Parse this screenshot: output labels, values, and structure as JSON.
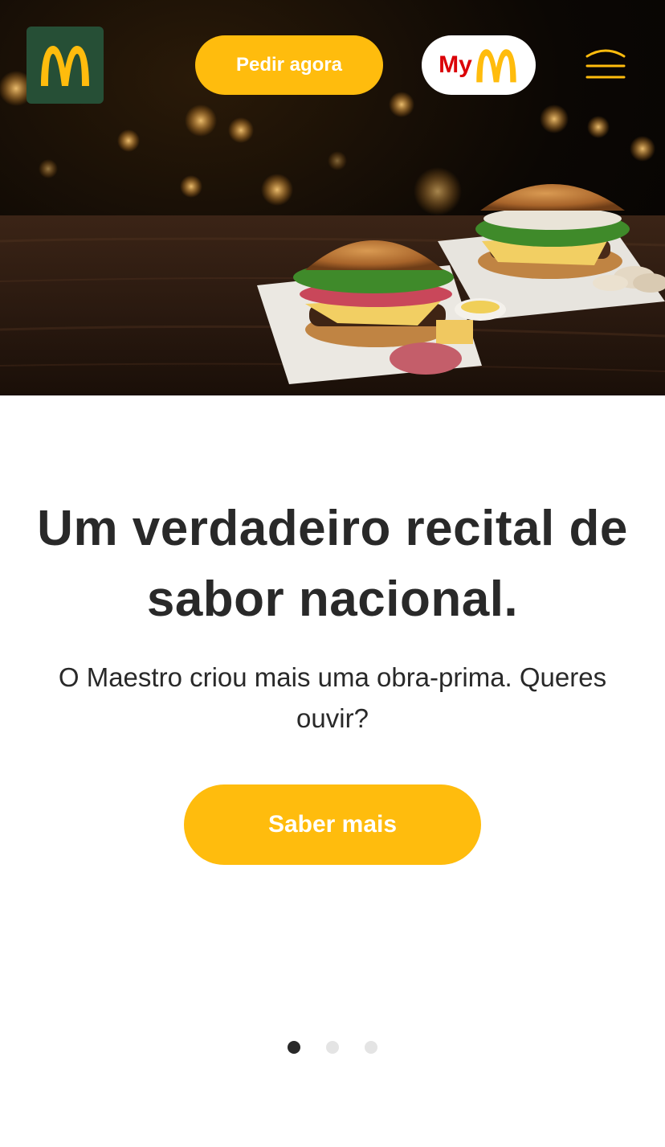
{
  "header": {
    "logo_icon": "golden-arches-logo",
    "order_button_label": "Pedir agora",
    "app_button": {
      "prefix": "My",
      "icon": "golden-arches-icon"
    },
    "menu_icon": "hamburger-menu-icon"
  },
  "hero": {
    "image": "two-burgers-on-wooden-table"
  },
  "promo": {
    "headline": "Um verdadeiro recital de sabor nacional.",
    "subtext": "O Maestro criou mais uma obra-prima. Queres ouvir?",
    "cta_label": "Saber mais"
  },
  "carousel": {
    "total_slides": 3,
    "active_slide": 1
  },
  "colors": {
    "brand_yellow": "#ffbc0d",
    "brand_green": "#264f36",
    "brand_red": "#db0007",
    "text_dark": "#292929",
    "dot_inactive": "#e4e4e4"
  }
}
